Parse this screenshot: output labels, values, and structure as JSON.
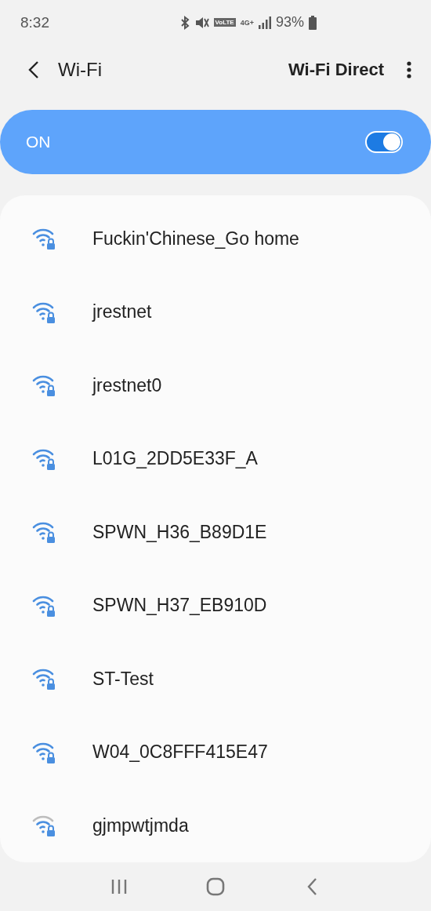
{
  "status_bar": {
    "time": "8:32",
    "volte": "VoLTE",
    "network": "4G+",
    "battery": "93%"
  },
  "header": {
    "title": "Wi-Fi",
    "action": "Wi-Fi Direct"
  },
  "master_switch": {
    "label": "ON",
    "on": true
  },
  "networks": [
    {
      "name": "Fuckin'Chinese_Go home",
      "kind": "full"
    },
    {
      "name": "jrestnet",
      "kind": "full"
    },
    {
      "name": "jrestnet0",
      "kind": "full"
    },
    {
      "name": "L01G_2DD5E33F_A",
      "kind": "full"
    },
    {
      "name": "SPWN_H36_B89D1E",
      "kind": "full"
    },
    {
      "name": "SPWN_H37_EB910D",
      "kind": "full"
    },
    {
      "name": "ST-Test",
      "kind": "full"
    },
    {
      "name": "W04_0C8FFF415E47",
      "kind": "full"
    },
    {
      "name": "gjmpwtjmda",
      "kind": "weak"
    }
  ]
}
